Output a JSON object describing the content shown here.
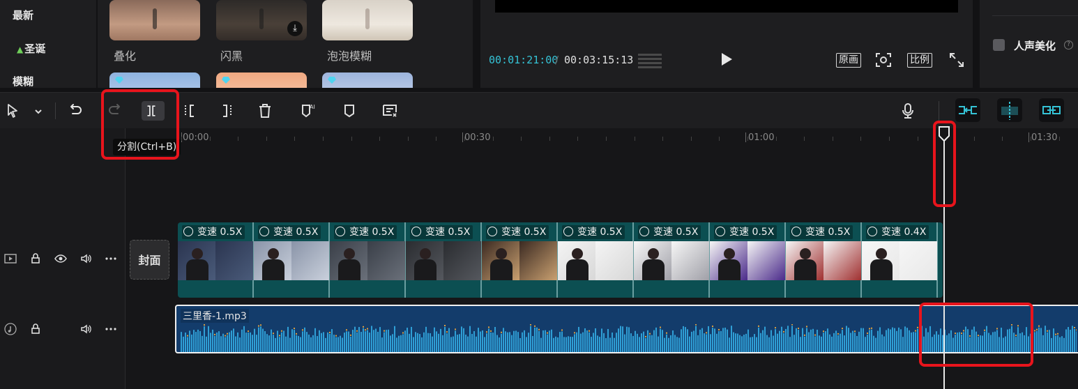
{
  "categories": [
    "最新",
    "圣诞",
    "模糊"
  ],
  "effects": [
    {
      "label": "叠化",
      "icon": "none"
    },
    {
      "label": "闪黑",
      "icon": "download-icon"
    },
    {
      "label": "泡泡模糊",
      "icon": "none"
    }
  ],
  "preview": {
    "current_time": "00:01:21:00",
    "separator": "/",
    "total_time": "00:03:15:13",
    "btn_original": "原画",
    "btn_ratio": "比例"
  },
  "properties": {
    "voice_beautify_label": "人声美化",
    "voice_beautify_checked": false,
    "help_mark": "?"
  },
  "toolbar": {
    "tooltip": "分割(Ctrl+B)",
    "icons": [
      "select-arrow-icon",
      "chevron-down-icon",
      "undo-icon",
      "redo-icon",
      "split-icon",
      "trim-left-icon",
      "trim-right-icon",
      "delete-icon",
      "auto-mark-icon",
      "marker-icon",
      "freeze-frame-icon",
      "microphone-icon",
      "link-snap-icon",
      "center-snap-icon",
      "link-clips-icon"
    ]
  },
  "timeline": {
    "ruler_labels": [
      "00:00",
      "00:30",
      "01:00",
      "01:30"
    ],
    "cover_label": "封面",
    "video_clips": [
      {
        "tag": "变速 0.5X"
      },
      {
        "tag": "变速 0.5X"
      },
      {
        "tag": "变速 0.5X"
      },
      {
        "tag": "变速 0.5X"
      },
      {
        "tag": "变速 0.5X"
      },
      {
        "tag": "变速 0.5X"
      },
      {
        "tag": "变速 0.5X"
      },
      {
        "tag": "变速 0.5X"
      },
      {
        "tag": "变速 0.5X"
      },
      {
        "tag": "变速 0.4X"
      }
    ],
    "audio_clip": {
      "label": "三里香-1.mp3"
    },
    "playhead_time": "00:01:21:00"
  },
  "colors": {
    "accent": "#35c3d6",
    "highlight_red": "#e8141c",
    "video_track": "#0c4f52",
    "audio_track": "#133c6b"
  }
}
